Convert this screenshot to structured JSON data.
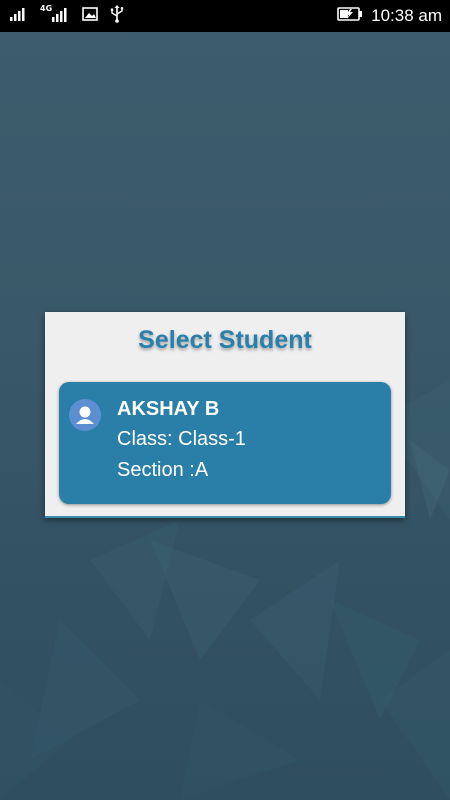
{
  "status_bar": {
    "network_type": "4G",
    "time": "10:38 am",
    "icons": [
      "signal-icon",
      "signal-4g-icon",
      "image-icon",
      "usb-icon",
      "battery-charging-icon"
    ]
  },
  "dialog": {
    "title": "Select Student"
  },
  "students": [
    {
      "name": "AKSHAY B",
      "class_line": "Class: Class-1",
      "section_line": "Section :A",
      "icon": "user-avatar-icon"
    }
  ],
  "colors": {
    "accent": "#2a7fab",
    "card": "#2a7fa8",
    "dialog_bg": "#efefef",
    "background": "#3a5968"
  }
}
